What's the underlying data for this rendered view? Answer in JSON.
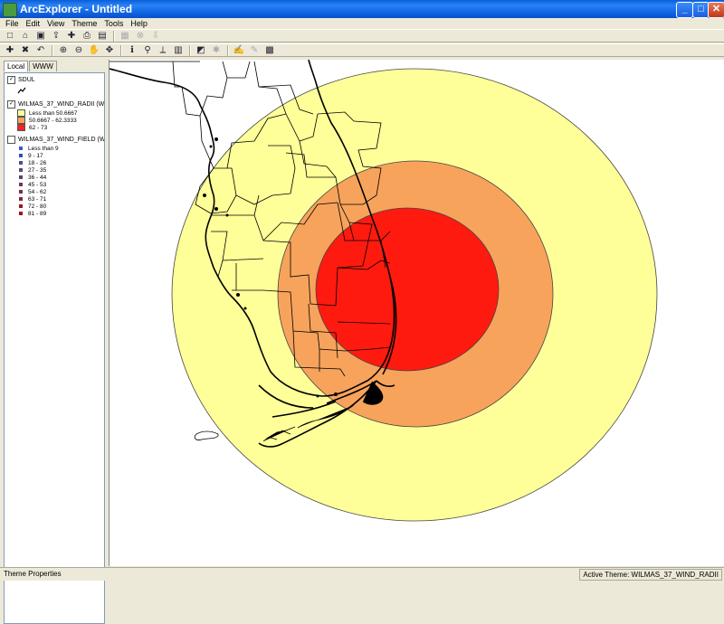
{
  "window": {
    "title": "ArcExplorer - Untitled"
  },
  "menu": [
    "File",
    "Edit",
    "View",
    "Theme",
    "Tools",
    "Help"
  ],
  "toolbar1": [
    "new-icon",
    "open-icon",
    "save-icon",
    "export-icon",
    "add-data-icon",
    "print-icon",
    "layout-icon",
    "sep",
    "catalog-icon",
    "stop-icon",
    "download-icon"
  ],
  "toolbar2": [
    "add-theme-icon",
    "remove-theme-icon",
    "undo-icon",
    "sep",
    "zoom-in-icon",
    "zoom-out-icon",
    "pan-icon",
    "move-icon",
    "sep",
    "identify-icon",
    "find-icon",
    "measure-icon",
    "query-icon",
    "sep",
    "select-icon",
    "select-point-icon",
    "sep",
    "hotlink-icon",
    "edit-icon",
    "properties-icon"
  ],
  "tabs": [
    "Local",
    "WWW"
  ],
  "themes": [
    {
      "name": "SDUL",
      "checked": true,
      "legend": []
    },
    {
      "name": "WILMAS_37_WIND_RADII (W",
      "checked": true,
      "legend": [
        {
          "label": "Less than 50.6667",
          "color": "#ffff99"
        },
        {
          "label": "50.6667 - 62.3333",
          "color": "#f7a35c"
        },
        {
          "label": "62 - 73",
          "color": "#ff2020"
        }
      ]
    },
    {
      "name": "WILMAS_37_WIND_FIELD (W",
      "checked": false,
      "legend": [
        {
          "label": "Less than 9",
          "color": "#3a5bc7"
        },
        {
          "label": "9 - 17",
          "color": "#3a4fa8"
        },
        {
          "label": "18 - 26",
          "color": "#474f8e"
        },
        {
          "label": "27 - 35",
          "color": "#524a78"
        },
        {
          "label": "36 - 44",
          "color": "#5b4266"
        },
        {
          "label": "45 - 53",
          "color": "#663a55"
        },
        {
          "label": "54 - 62",
          "color": "#753044"
        },
        {
          "label": "63 - 71",
          "color": "#842634"
        },
        {
          "label": "72 - 80",
          "color": "#941a24"
        },
        {
          "label": "81 - 89",
          "color": "#a80e14"
        }
      ]
    }
  ],
  "status": {
    "left": "Theme Properties",
    "right": "Active Theme: WILMAS_37_WIND_RADII"
  }
}
